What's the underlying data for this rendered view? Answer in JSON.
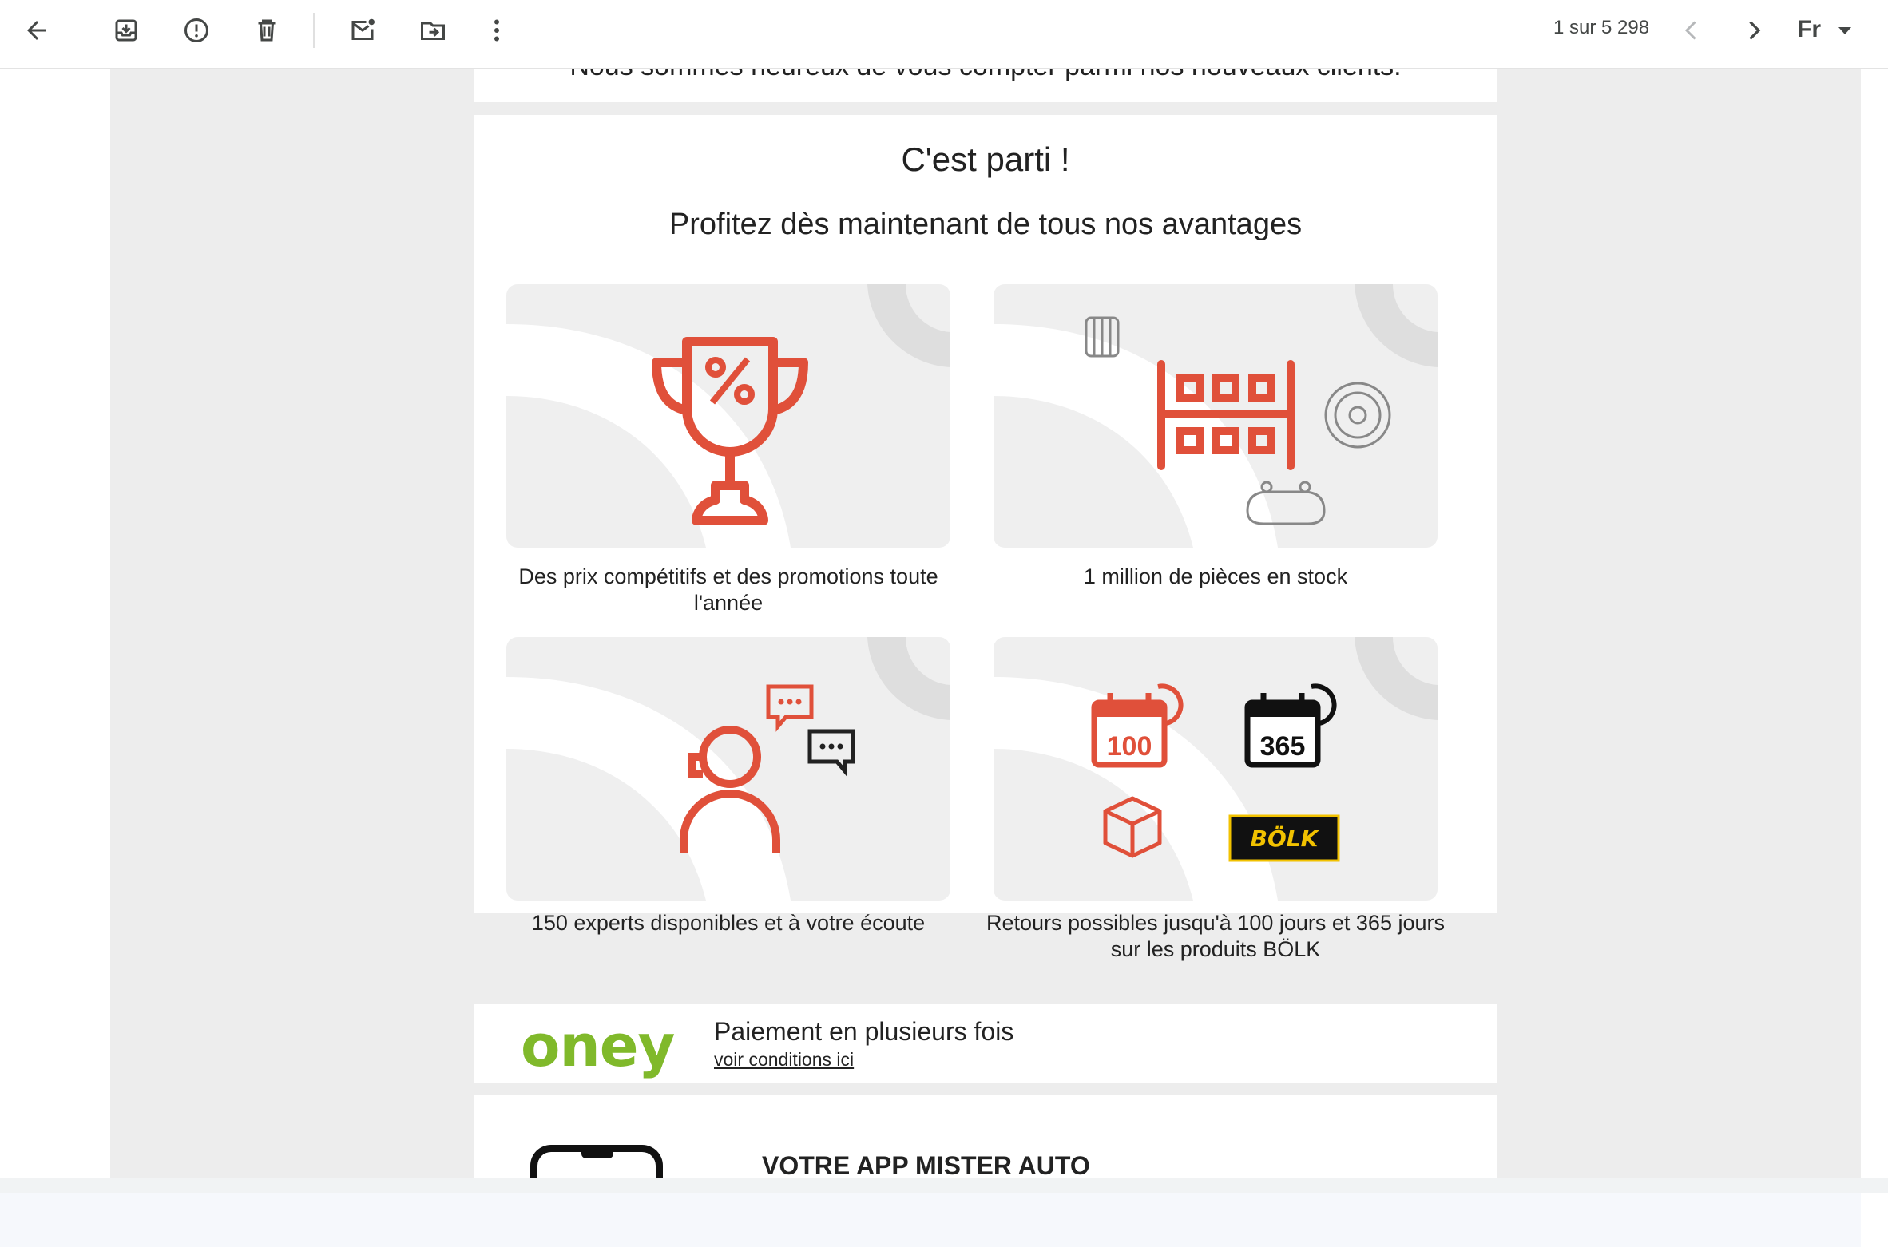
{
  "toolbar": {
    "back": "back-arrow-icon",
    "archive": "archive-icon",
    "spam": "report-spam-icon",
    "delete": "trash-icon",
    "unread": "mark-unread-icon",
    "move": "move-to-icon",
    "more": "more-vertical-icon",
    "pager": "1 sur 5 298",
    "lang": "Fr"
  },
  "email": {
    "cut_text": "Nous sommes heureux de vous compter parmi nos nouveaux clients.",
    "title": "C'est parti !",
    "subtitle": "Profitez dès maintenant de tous nos avantages",
    "cards": [
      {
        "caption": "Des prix compétitifs et des promotions toute l'année",
        "icon": "trophy-percent-icon"
      },
      {
        "caption": "1 million de pièces en stock",
        "icon": "parts-shelf-icon"
      },
      {
        "caption": "150 experts disponibles et à votre écoute",
        "icon": "expert-chat-icon"
      },
      {
        "caption": "Retours possibles jusqu'à 100 jours et 365 jours sur les produits BÖLK",
        "icon": "returns-calendar-icon",
        "cal1": "100",
        "cal2": "365",
        "brand": "BÖLK"
      }
    ],
    "oney": {
      "logo": "oney",
      "title": "Paiement en plusieurs fois",
      "link": "voir conditions ici"
    },
    "app": {
      "title": "VOTRE APP MISTER AUTO"
    }
  },
  "colors": {
    "accent": "#e0503a",
    "oney": "#80b92b",
    "brand_yellow": "#f2c200"
  }
}
